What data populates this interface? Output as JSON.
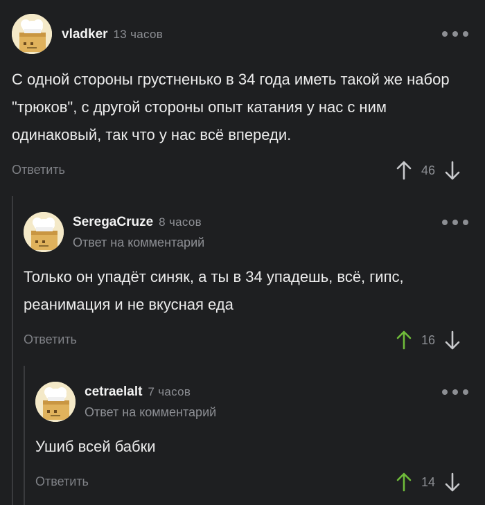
{
  "comments": [
    {
      "username": "vladker",
      "time": "13 часов",
      "text": "С одной стороны грустненько в 34 года иметь такой же набор \"трюков\", с другой стороны опыт катания у нас с ним одинаковый, так что у нас всё впереди.",
      "reply_button": "Ответить",
      "rating": "46",
      "upvoted": false
    },
    {
      "username": "SeregaCruze",
      "time": "8 часов",
      "reply_label": "Ответ на комментарий",
      "text": "Только он упадёт синяк, а ты в 34 упадешь, всё, гипс, реанимация и не вкусная еда",
      "reply_button": "Ответить",
      "rating": "16",
      "upvoted": true
    },
    {
      "username": "cetraelalt",
      "time": "7 часов",
      "reply_label": "Ответ на комментарий",
      "text": "Ушиб всей бабки",
      "reply_button": "Ответить",
      "rating": "14",
      "upvoted": true
    }
  ],
  "icons": {
    "upvote_active_color": "#6fbb3a",
    "upvote_inactive_color": "#c9cacd",
    "downvote_color": "#c9cacd",
    "more": "more-dots-icon"
  }
}
